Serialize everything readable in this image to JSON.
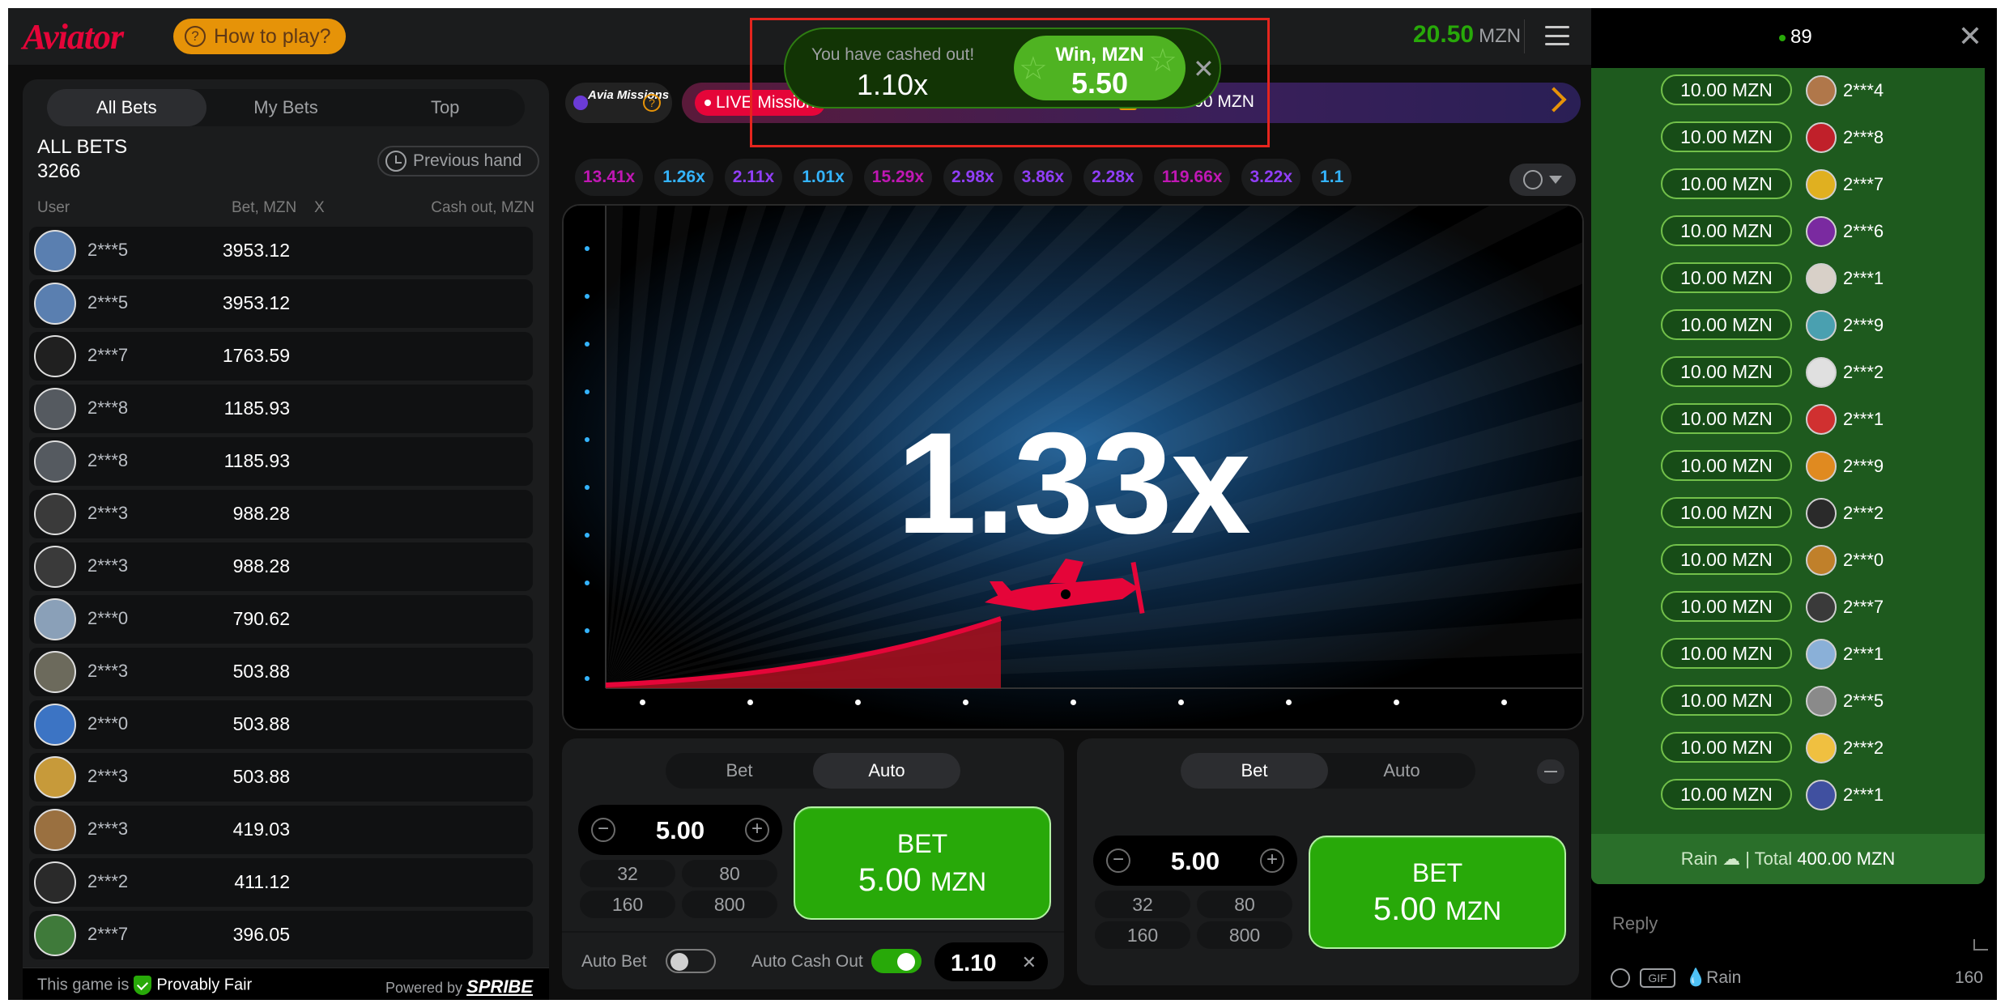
{
  "header": {
    "logo": "Aviator",
    "how_to_play": "How to play?",
    "balance": "20.50",
    "currency": "MZN"
  },
  "left": {
    "tabs": [
      "All Bets",
      "My Bets",
      "Top"
    ],
    "title": "ALL BETS",
    "count": "3266",
    "previous_hand": "Previous hand",
    "columns": {
      "user": "User",
      "bet": "Bet, MZN",
      "x": "X",
      "cashout": "Cash out, MZN"
    },
    "rows": [
      {
        "user": "2***5",
        "bet": "3953.12",
        "avatar_color": "#5a7fb0"
      },
      {
        "user": "2***5",
        "bet": "3953.12",
        "avatar_color": "#5a7fb0"
      },
      {
        "user": "2***7",
        "bet": "1763.59",
        "avatar_color": "#202020"
      },
      {
        "user": "2***8",
        "bet": "1185.93",
        "avatar_color": "#555a60"
      },
      {
        "user": "2***8",
        "bet": "1185.93",
        "avatar_color": "#555a60"
      },
      {
        "user": "2***3",
        "bet": "988.28",
        "avatar_color": "#3a3a3a"
      },
      {
        "user": "2***3",
        "bet": "988.28",
        "avatar_color": "#3a3a3a"
      },
      {
        "user": "2***0",
        "bet": "790.62",
        "avatar_color": "#8aa0b8"
      },
      {
        "user": "2***3",
        "bet": "503.88",
        "avatar_color": "#6c6a5c"
      },
      {
        "user": "2***0",
        "bet": "503.88",
        "avatar_color": "#3c74c4"
      },
      {
        "user": "2***3",
        "bet": "503.88",
        "avatar_color": "#c79a3a"
      },
      {
        "user": "2***3",
        "bet": "419.03",
        "avatar_color": "#9a7040"
      },
      {
        "user": "2***2",
        "bet": "411.12",
        "avatar_color": "#2a2a2a"
      },
      {
        "user": "2***7",
        "bet": "396.05",
        "avatar_color": "#3f7a3a"
      }
    ],
    "footer": {
      "fair_prefix": "This game is",
      "fair_label": "Provably Fair",
      "powered_prefix": "Powered by",
      "powered_brand": "SPRIBE"
    }
  },
  "missions": {
    "label": "Avia Missions",
    "live": "LIVE Mission",
    "prize": "20000.00 MZN"
  },
  "history": [
    {
      "value": "13.41x",
      "color": "#c017b4"
    },
    {
      "value": "1.26x",
      "color": "#34b4ff"
    },
    {
      "value": "2.11x",
      "color": "#913ef8"
    },
    {
      "value": "1.01x",
      "color": "#34b4ff"
    },
    {
      "value": "15.29x",
      "color": "#c017b4"
    },
    {
      "value": "2.98x",
      "color": "#913ef8"
    },
    {
      "value": "3.86x",
      "color": "#913ef8"
    },
    {
      "value": "2.28x",
      "color": "#913ef8"
    },
    {
      "value": "119.66x",
      "color": "#c017b4"
    },
    {
      "value": "3.22x",
      "color": "#913ef8"
    },
    {
      "value": "1.1",
      "color": "#34b4ff"
    }
  ],
  "game": {
    "multiplier": "1.33x"
  },
  "toast": {
    "message": "You have cashed out!",
    "cashout_mult": "1.10x",
    "win_label": "Win, MZN",
    "win_amount": "5.50"
  },
  "bet1": {
    "tabs": [
      "Bet",
      "Auto"
    ],
    "active_tab": "Auto",
    "amount": "5.00",
    "quick": [
      "32",
      "80",
      "160",
      "800"
    ],
    "btn_line1": "BET",
    "btn_amount": "5.00",
    "btn_currency": "MZN",
    "auto_bet": "Auto Bet",
    "auto_cashout": "Auto Cash Out",
    "auto_cashout_value": "1.10"
  },
  "bet2": {
    "tabs": [
      "Bet",
      "Auto"
    ],
    "active_tab": "Bet",
    "amount": "5.00",
    "quick": [
      "32",
      "80",
      "160",
      "800"
    ],
    "btn_line1": "BET",
    "btn_amount": "5.00",
    "btn_currency": "MZN"
  },
  "chat": {
    "online": "89",
    "rain_rows": [
      {
        "amount": "10.00 MZN",
        "user": "2***4",
        "avatar_color": "#b0774a"
      },
      {
        "amount": "10.00 MZN",
        "user": "2***8",
        "avatar_color": "#c0202a"
      },
      {
        "amount": "10.00 MZN",
        "user": "2***7",
        "avatar_color": "#e0b020"
      },
      {
        "amount": "10.00 MZN",
        "user": "2***6",
        "avatar_color": "#7a2aa0"
      },
      {
        "amount": "10.00 MZN",
        "user": "2***1",
        "avatar_color": "#d8d0c8"
      },
      {
        "amount": "10.00 MZN",
        "user": "2***9",
        "avatar_color": "#4aa0b0"
      },
      {
        "amount": "10.00 MZN",
        "user": "2***2",
        "avatar_color": "#e0e0e0"
      },
      {
        "amount": "10.00 MZN",
        "user": "2***1",
        "avatar_color": "#d03030"
      },
      {
        "amount": "10.00 MZN",
        "user": "2***9",
        "avatar_color": "#e08a20"
      },
      {
        "amount": "10.00 MZN",
        "user": "2***2",
        "avatar_color": "#2a2a2a"
      },
      {
        "amount": "10.00 MZN",
        "user": "2***0",
        "avatar_color": "#c0802a"
      },
      {
        "amount": "10.00 MZN",
        "user": "2***7",
        "avatar_color": "#3a3a3a"
      },
      {
        "amount": "10.00 MZN",
        "user": "2***1",
        "avatar_color": "#8ab0d8"
      },
      {
        "amount": "10.00 MZN",
        "user": "2***5",
        "avatar_color": "#8a8a8a"
      },
      {
        "amount": "10.00 MZN",
        "user": "2***2",
        "avatar_color": "#f0c040"
      },
      {
        "amount": "10.00 MZN",
        "user": "2***1",
        "avatar_color": "#4050a0"
      }
    ],
    "rain_prefix": "Rain",
    "rain_total_label": "| Total",
    "rain_total": "400.00 MZN",
    "reply_placeholder": "Reply",
    "gif": "GIF",
    "rain_btn": "Rain",
    "char_count": "160"
  }
}
